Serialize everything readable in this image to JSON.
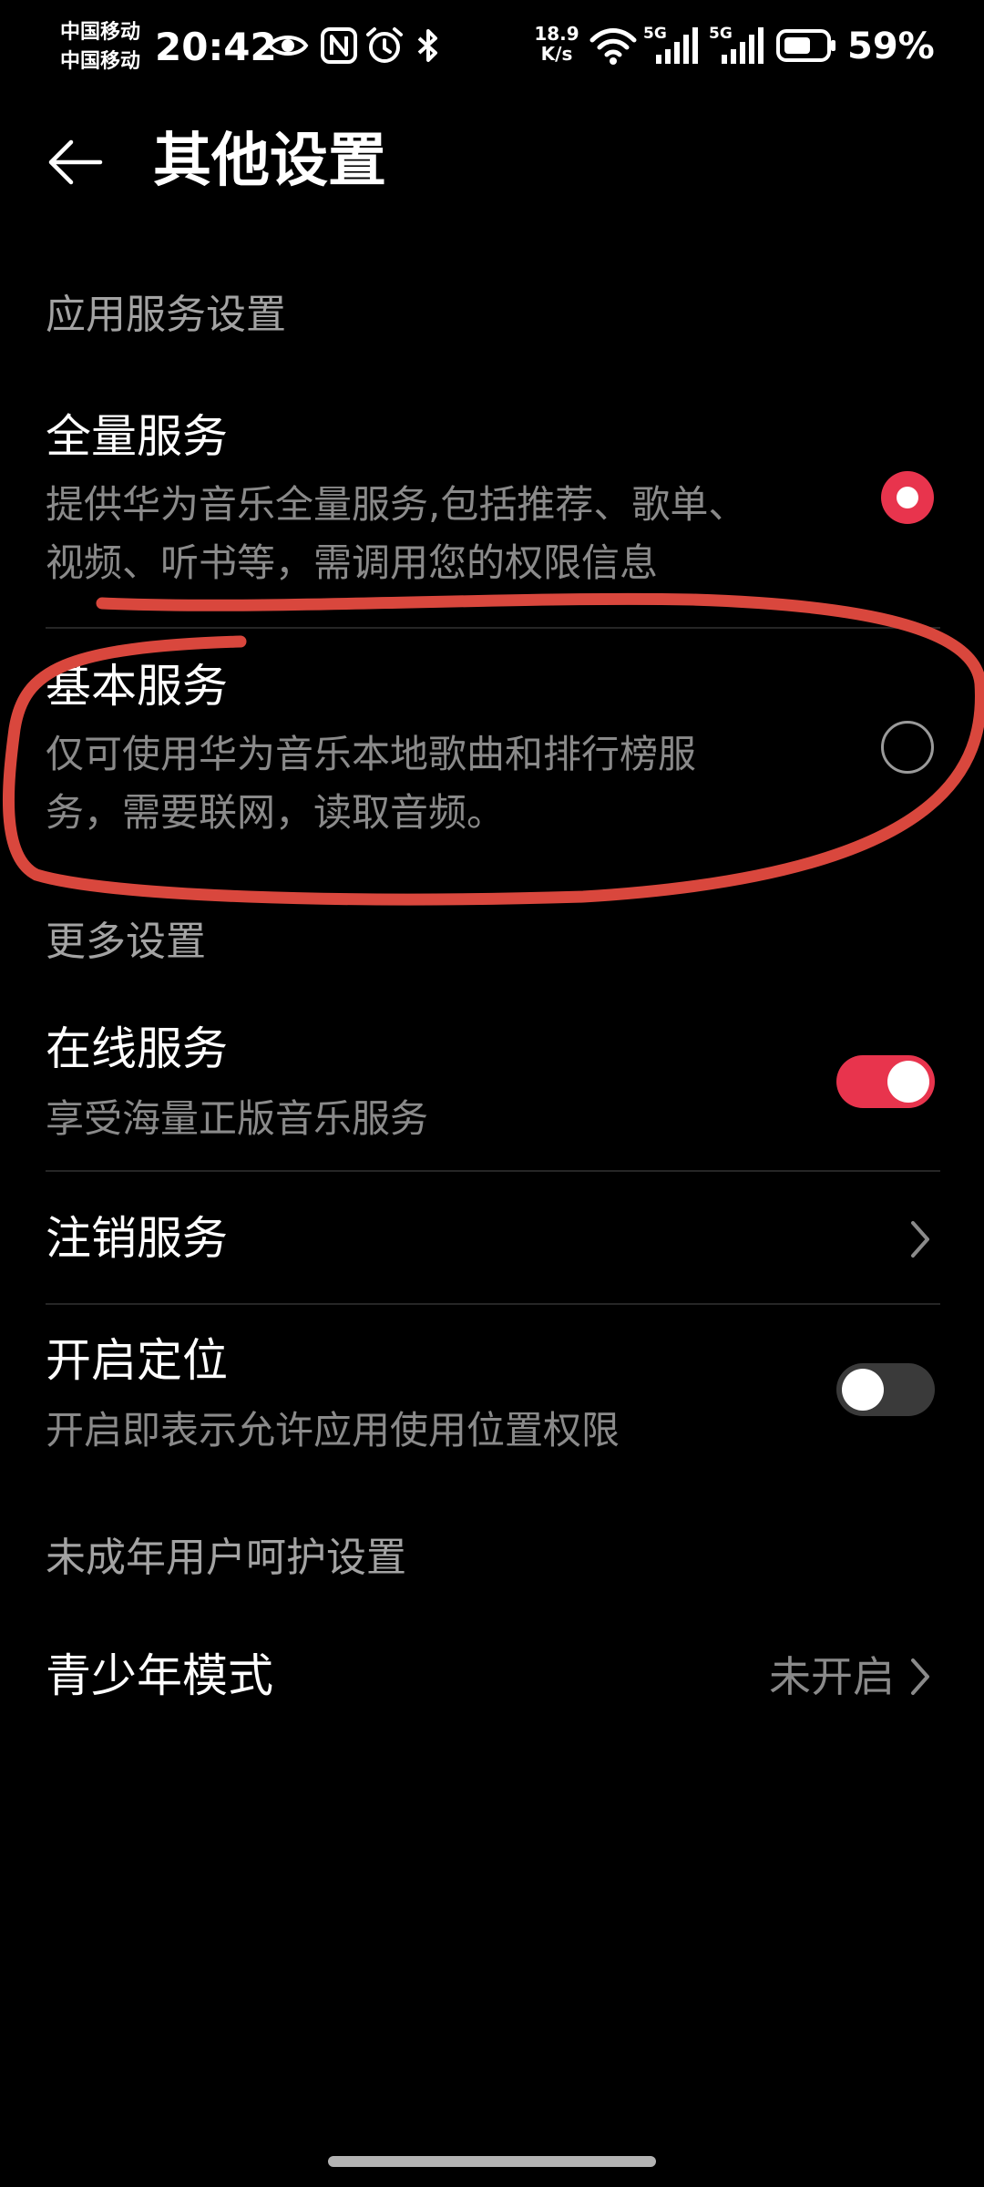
{
  "status_bar": {
    "carrier_1": "中国移动",
    "carrier_2": "中国移动",
    "time": "20:42",
    "net_speed_value": "18.9",
    "net_speed_unit": "K/s",
    "sim1_label": "5G",
    "sim2_label": "5G",
    "battery": "59%",
    "icons": [
      "eye-icon",
      "nfc-icon",
      "alarm-icon",
      "bluetooth-icon",
      "wifi-icon",
      "signal-icon",
      "battery-icon"
    ]
  },
  "header": {
    "title": "其他设置",
    "back_icon": "arrow-left-icon"
  },
  "app_service": {
    "label": "应用服务设置",
    "items": [
      {
        "title": "全量服务",
        "desc_line1": "提供华为音乐全量服务,包括推荐、歌单、",
        "desc_line2": "视频、听书等，需调用您的权限信息",
        "selected": true
      },
      {
        "title": "基本服务",
        "desc_line1": "仅可使用华为音乐本地歌曲和排行榜服",
        "desc_line2": "务，需要联网，读取音频。",
        "selected": false
      }
    ]
  },
  "more_settings": {
    "label": "更多设置",
    "online": {
      "title": "在线服务",
      "desc": "享受海量正版音乐服务",
      "enabled": true
    },
    "logout": {
      "title": "注销服务"
    },
    "location": {
      "title": "开启定位",
      "desc": "开启即表示允许应用使用位置权限",
      "enabled": false
    }
  },
  "minor_settings": {
    "label": "未成年用户呵护设置",
    "teen_mode": {
      "title": "青少年模式",
      "value": "未开启"
    }
  },
  "colors": {
    "accent": "#e8344d",
    "annotation": "#d9473d",
    "background": "#000000",
    "secondary_text": "#8a8a8a",
    "toggle_off": "#3a3a3a"
  }
}
